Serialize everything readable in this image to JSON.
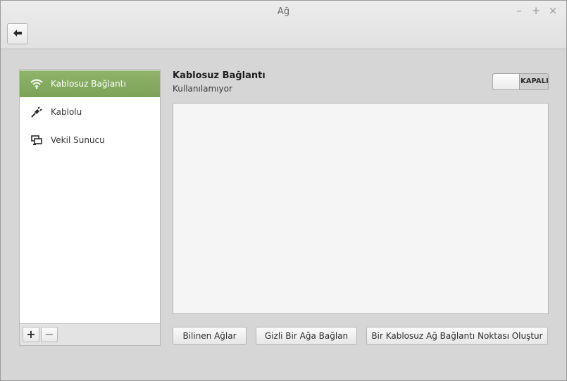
{
  "window": {
    "title": "Ağ"
  },
  "titlebar": {
    "minimize": "–",
    "maximize": "+",
    "close": "×"
  },
  "sidebar": {
    "items": [
      {
        "label": "Kablosuz Bağlantı",
        "icon": "wifi-icon",
        "active": true
      },
      {
        "label": "Kablolu",
        "icon": "ethernet-plug-icon",
        "active": false
      },
      {
        "label": "Vekil Sunucu",
        "icon": "proxy-icon",
        "active": false
      }
    ],
    "add_label": "+",
    "remove_label": "−"
  },
  "main": {
    "title": "Kablosuz Bağlantı",
    "status": "Kullanılamıyor",
    "switch_state": "KAPALI",
    "buttons": {
      "known_networks": "Bilinen Ağlar",
      "hidden_network": "Gizli Bir Ağa Bağlan",
      "hotspot": "Bir Kablosuz Ağ Bağlantı Noktası Oluştur"
    }
  },
  "colors": {
    "accent": "#86ad61",
    "background": "#d6d6d6"
  }
}
